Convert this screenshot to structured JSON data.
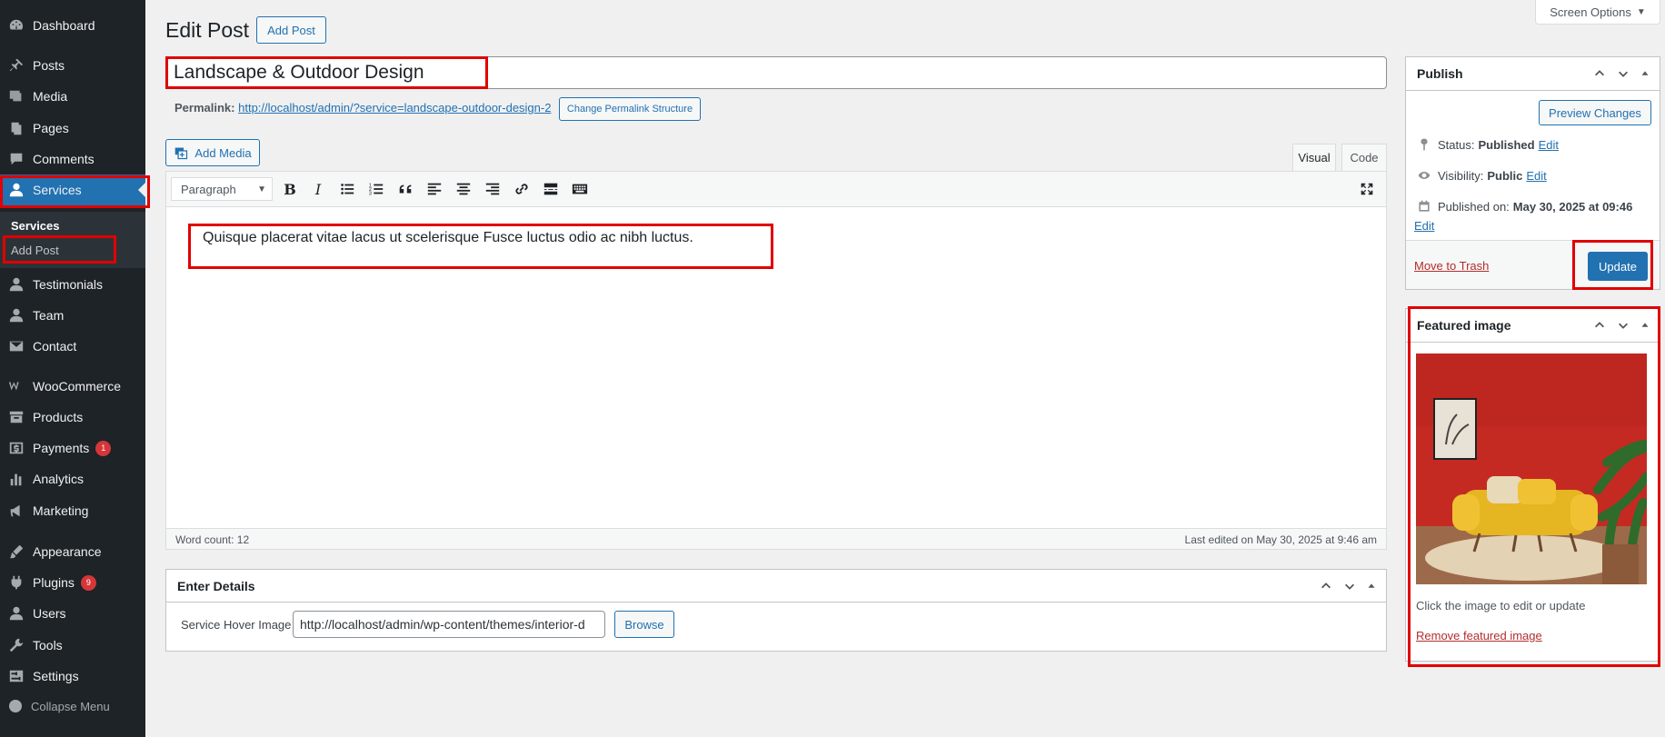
{
  "sidebar": {
    "items": [
      {
        "label": "Dashboard",
        "icon": "dashboard-icon"
      },
      {
        "label": "Posts",
        "icon": "pin-icon"
      },
      {
        "label": "Media",
        "icon": "media-icon"
      },
      {
        "label": "Pages",
        "icon": "pages-icon"
      },
      {
        "label": "Comments",
        "icon": "comment-icon"
      },
      {
        "label": "Services",
        "icon": "user-icon"
      },
      {
        "label": "Testimonials",
        "icon": "user-icon"
      },
      {
        "label": "Team",
        "icon": "user-icon"
      },
      {
        "label": "Contact",
        "icon": "mail-icon"
      },
      {
        "label": "WooCommerce",
        "icon": "woo-icon"
      },
      {
        "label": "Products",
        "icon": "archive-icon"
      },
      {
        "label": "Payments",
        "icon": "dollar-icon",
        "badge": "1"
      },
      {
        "label": "Analytics",
        "icon": "bar-chart-icon"
      },
      {
        "label": "Marketing",
        "icon": "megaphone-icon"
      },
      {
        "label": "Appearance",
        "icon": "brush-icon"
      },
      {
        "label": "Plugins",
        "icon": "plug-icon",
        "badge": "9"
      },
      {
        "label": "Users",
        "icon": "user-icon"
      },
      {
        "label": "Tools",
        "icon": "wrench-icon"
      },
      {
        "label": "Settings",
        "icon": "settings-icon"
      }
    ],
    "submenu_title": "Services",
    "submenu_item": "Add Post",
    "collapse_label": "Collapse Menu"
  },
  "header": {
    "title": "Edit Post",
    "add_post": "Add Post",
    "screen_options": "Screen Options"
  },
  "post": {
    "title": "Landscape & Outdoor Design",
    "permalink_label": "Permalink:",
    "permalink_url": "http://localhost/admin/?service=landscape-outdoor-design-2",
    "change_permalink": "Change Permalink Structure"
  },
  "editor": {
    "add_media": "Add Media",
    "tab_visual": "Visual",
    "tab_code": "Code",
    "format": "Paragraph",
    "content": "Quisque placerat vitae lacus ut scelerisque Fusce luctus odio ac nibh luctus.",
    "word_count": "Word count: 12",
    "last_edited": "Last edited on May 30, 2025 at 9:46 am"
  },
  "details": {
    "title": "Enter Details",
    "field_label": "Service Hover Image",
    "field_value": "http://localhost/admin/wp-content/themes/interior-d",
    "browse": "Browse"
  },
  "publish": {
    "title": "Publish",
    "preview": "Preview Changes",
    "status_label": "Status:",
    "status_value": "Published",
    "visibility_label": "Visibility:",
    "visibility_value": "Public",
    "published_on_label": "Published on:",
    "published_on_value": "May 30, 2025 at 09:46",
    "edit": "Edit",
    "trash": "Move to Trash",
    "update": "Update"
  },
  "featured": {
    "title": "Featured image",
    "hint": "Click the image to edit or update",
    "remove": "Remove featured image"
  },
  "colors": {
    "accent": "#2271b1",
    "sidebar_bg": "#1d2327",
    "highlight_box": "#e00000",
    "danger": "#b32d2e"
  }
}
